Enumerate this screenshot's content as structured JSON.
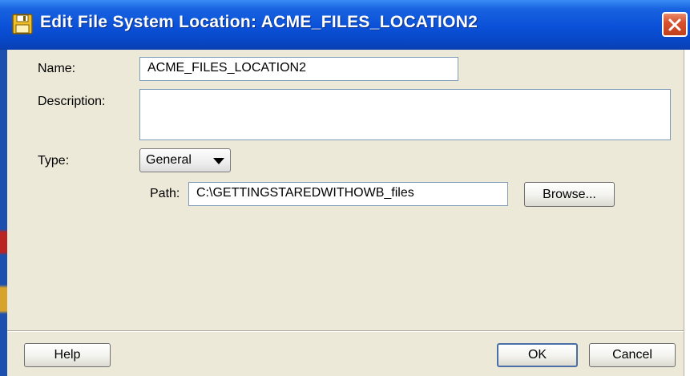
{
  "window": {
    "title": "Edit File System Location: ACME_FILES_LOCATION2"
  },
  "colors": {
    "title_bar": "#0a50d8",
    "close_button": "#d8512f",
    "dialog_background": "#ece9d8",
    "field_border": "#7f9db9"
  },
  "icons": {
    "title": "floppy-disk-icon",
    "close": "close-icon",
    "dropdown": "triangle-down-icon"
  },
  "form": {
    "name_label": "Name:",
    "name_value": "ACME_FILES_LOCATION2",
    "description_label": "Description:",
    "description_value": "",
    "type_label": "Type:",
    "type_value": "General",
    "path_label": "Path:",
    "path_value": "C:\\GETTINGSTAREDWITHOWB_files",
    "browse_label": "Browse..."
  },
  "footer": {
    "help_label": "Help",
    "ok_label": "OK",
    "cancel_label": "Cancel"
  }
}
